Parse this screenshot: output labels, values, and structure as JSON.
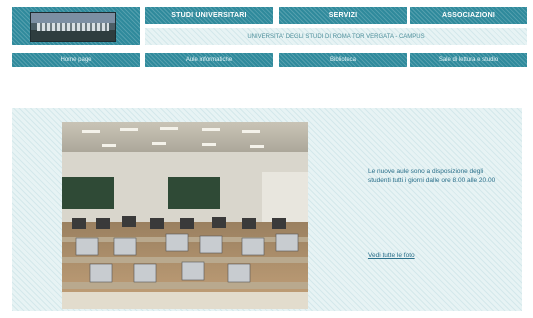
{
  "header": {
    "tabs": [
      {
        "label": "STUDI UNIVERSITARI"
      },
      {
        "label": "SERVIZI"
      },
      {
        "label": "ASSOCIAZIONI"
      }
    ],
    "info_text": "UNIVERSITA' DEGLI STUDI DI ROMA TOR VERGATA - CAMPUS"
  },
  "nav": {
    "items": [
      {
        "label": "Home page"
      },
      {
        "label": "Aule informatiche"
      },
      {
        "label": "Biblioteca"
      },
      {
        "label": "Sale di lettura e studio"
      }
    ]
  },
  "main": {
    "caption": "Le nuove aule sono a disposizione degli studenti tutti i giorni dalle ore 8.00 alle 20.00",
    "link_label": "Vedi tutte le foto"
  },
  "colors": {
    "bar": "#2f8a9c",
    "panel": "#e7f3f4",
    "caption_text": "#2a6f8a"
  }
}
